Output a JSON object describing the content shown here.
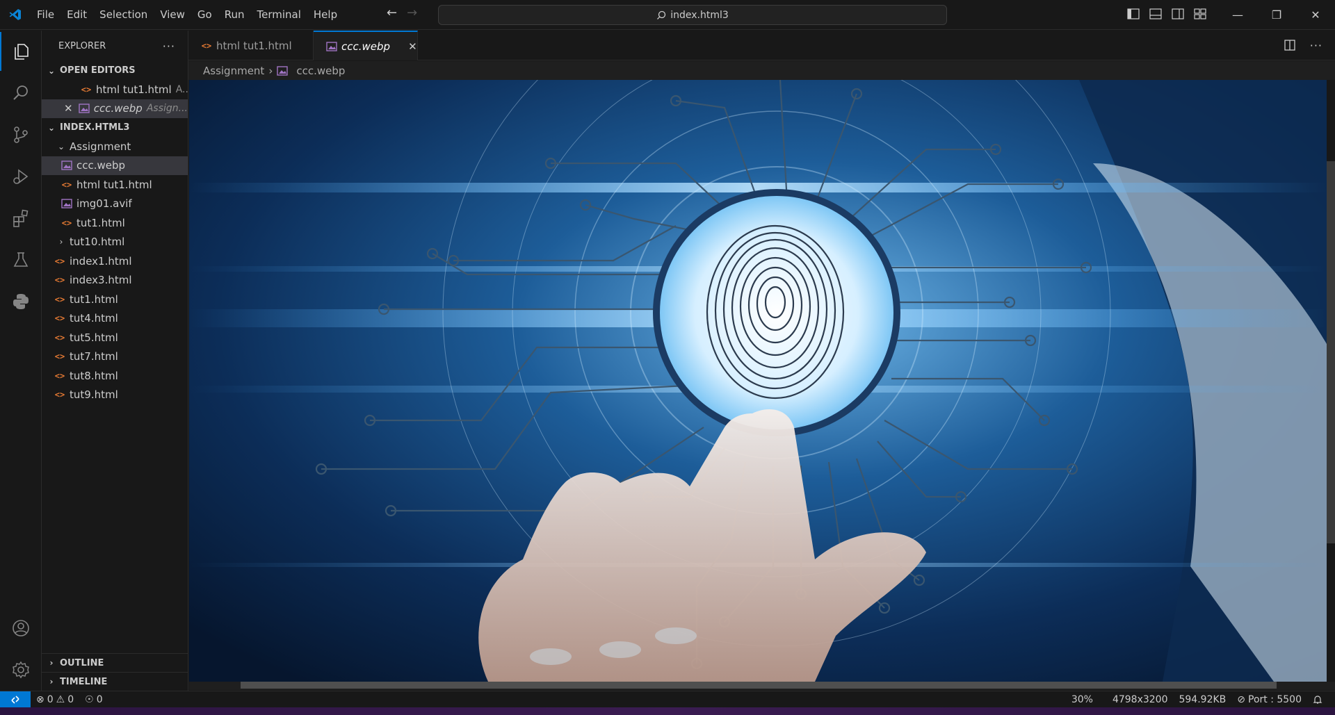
{
  "menu": [
    "File",
    "Edit",
    "Selection",
    "View",
    "Go",
    "Run",
    "Terminal",
    "Help"
  ],
  "command_center": "index.html3",
  "activity": [
    "explorer-icon",
    "search-icon",
    "source-control-icon",
    "run-debug-icon",
    "extensions-icon",
    "testing-icon",
    "python-icon",
    "accounts-icon",
    "settings-gear-icon"
  ],
  "sidebar": {
    "title": "EXPLORER",
    "open_editors": {
      "title": "OPEN EDITORS",
      "items": [
        {
          "name": "html tut1.html",
          "hint": "A..."
        },
        {
          "name": "ccc.webp",
          "hint": "Assign..."
        }
      ]
    },
    "workspace": {
      "title": "INDEX.HTML3",
      "folder": "Assignment",
      "folder_files": [
        "ccc.webp",
        "html tut1.html",
        "img01.avif",
        "tut1.html"
      ],
      "subfolder": "tut10.html",
      "files": [
        "index1.html",
        "index3.html",
        "tut1.html",
        "tut4.html",
        "tut5.html",
        "tut7.html",
        "tut8.html",
        "tut9.html"
      ]
    },
    "outline": "OUTLINE",
    "timeline": "TIMELINE"
  },
  "tabs": [
    {
      "label": "html tut1.html"
    },
    {
      "label": "ccc.webp"
    }
  ],
  "breadcrumb": {
    "folder": "Assignment",
    "file": "ccc.webp"
  },
  "status": {
    "errors": "0",
    "warnings": "0",
    "ports": "0",
    "zoom": "30%",
    "dimensions": "4798x3200",
    "size": "594.92KB",
    "port": "Port : 5500"
  },
  "colors": {
    "accent": "#0078d4",
    "html_icon": "#e37933",
    "image_icon": "#a074c4"
  }
}
